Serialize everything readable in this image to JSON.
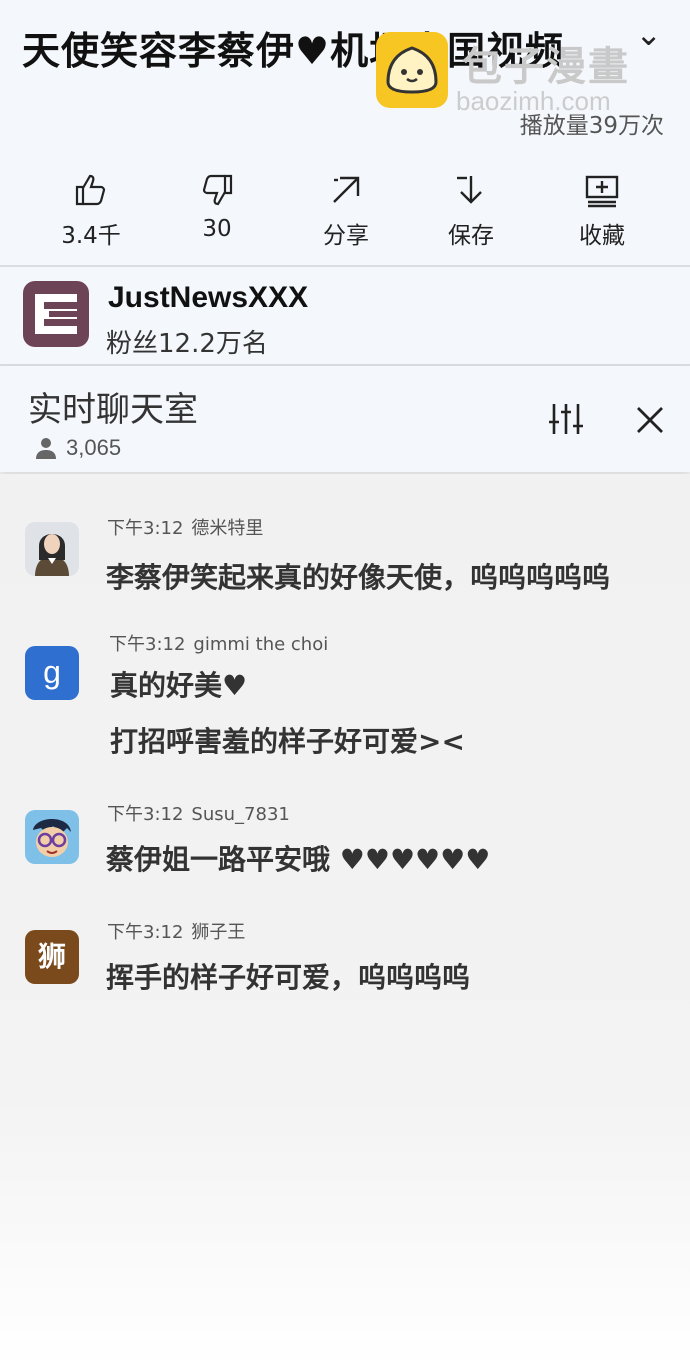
{
  "video": {
    "title": "天使笑容李蔡伊♥机场出国视频",
    "views": "播放量39万次"
  },
  "watermark": {
    "name": "包子漫畫",
    "url": "baozimh.com"
  },
  "actions": [
    {
      "icon": "thumbs-up-icon",
      "label": "3.4千"
    },
    {
      "icon": "thumbs-down-icon",
      "label": "30"
    },
    {
      "icon": "share-icon",
      "label": "分享"
    },
    {
      "icon": "save-icon",
      "label": "保存"
    },
    {
      "icon": "add-to-playlist-icon",
      "label": "收藏"
    }
  ],
  "channel": {
    "name": "JustNewsXXX",
    "subscribers": "粉丝12.2万名",
    "avatar_color": "#6d4456"
  },
  "chat": {
    "title": "实时聊天室",
    "viewers": "3,065",
    "messages": [
      {
        "time": "下午3:12",
        "author": "德米特里",
        "lines": [
          "李蔡伊笑起来真的好像天使，呜呜呜呜呜"
        ],
        "avatar": "woman-portrait-avatar"
      },
      {
        "time": "下午3:12",
        "author": "gimmi the choi",
        "lines": [
          "真的好美♥",
          "打招呼害羞的样子好可爱><"
        ],
        "avatar": "g-letter-avatar",
        "avatar_text": "g"
      },
      {
        "time": "下午3:12",
        "author": "Susu_7831",
        "lines": [
          "蔡伊姐一路平安哦 ♥♥♥♥♥♥"
        ],
        "avatar": "cartoon-boy-avatar"
      },
      {
        "time": "下午3:12",
        "author": "狮子王",
        "lines": [
          "挥手的样子好可爱，呜呜呜呜"
        ],
        "avatar": "lion-char-avatar",
        "avatar_text": "狮"
      }
    ]
  }
}
